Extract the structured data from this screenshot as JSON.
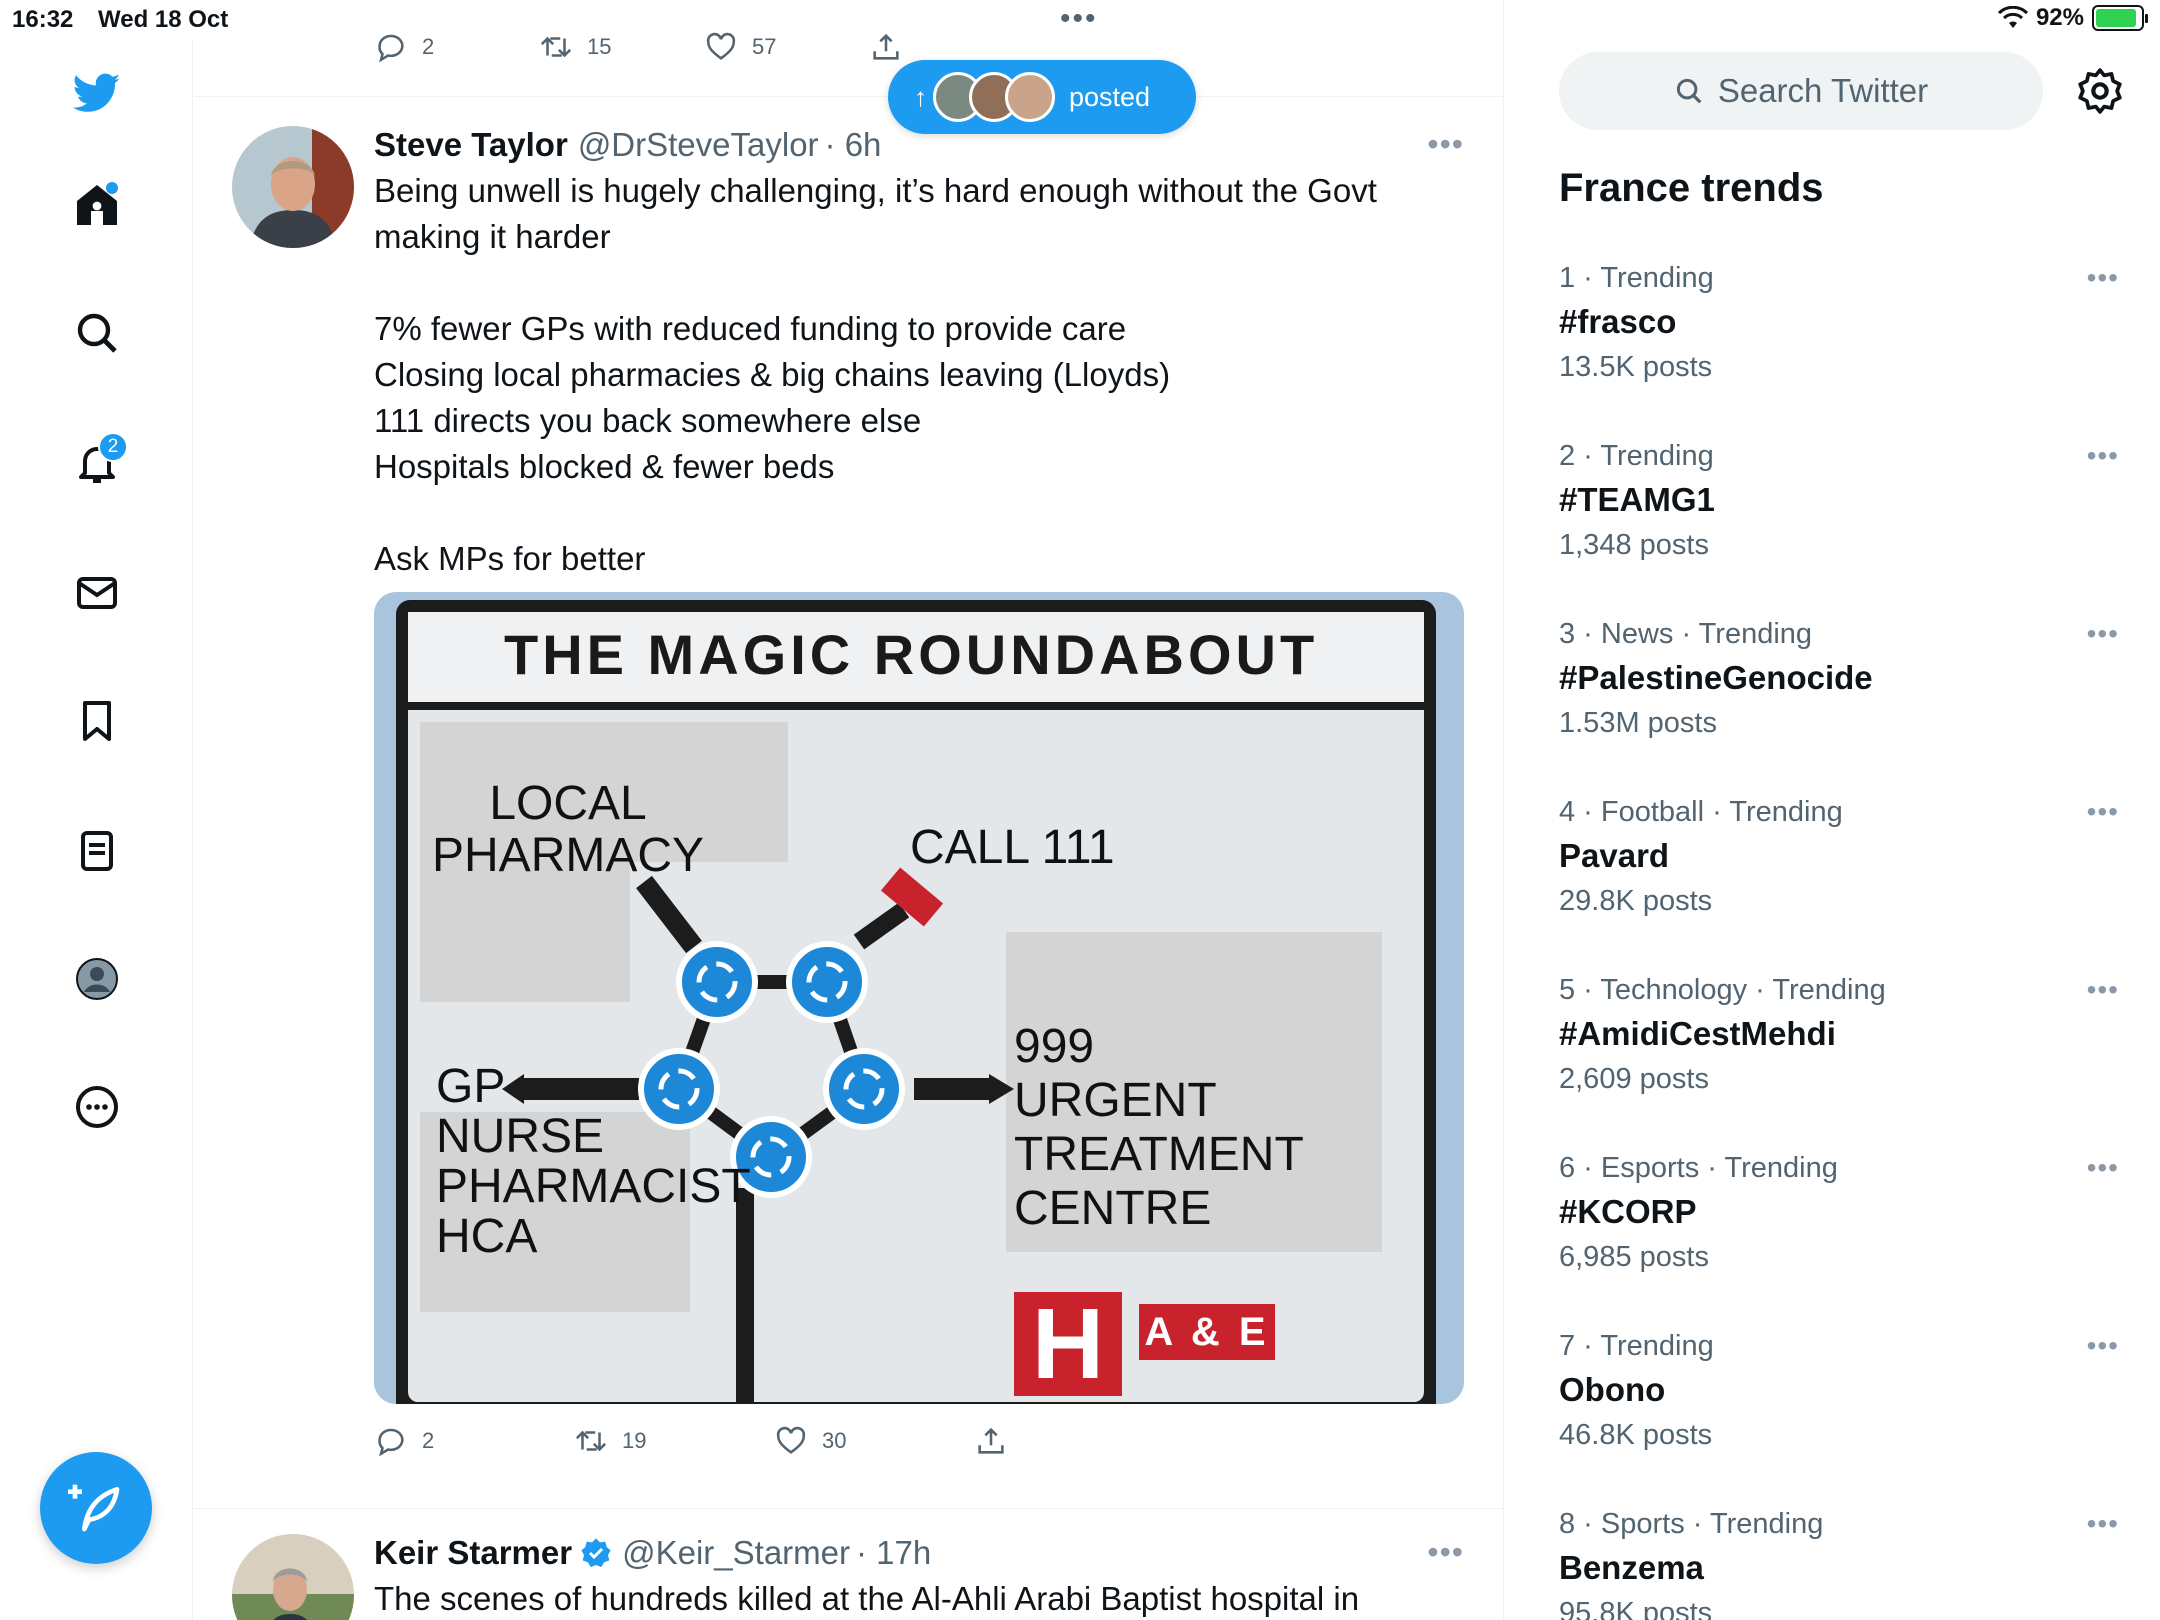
{
  "status_bar": {
    "time": "16:32",
    "date": "Wed 18 Oct",
    "battery": "92%",
    "battery_level": 0.92
  },
  "nav": {
    "notifications_badge": "2"
  },
  "colors": {
    "accent": "#1d9bf0",
    "text": "#0f1419",
    "muted": "#536471",
    "sign_red": "#c8232c"
  },
  "prev_tweet": {
    "replies": "2",
    "retweets": "15",
    "likes": "57"
  },
  "posted_pill": {
    "label": "posted"
  },
  "tweets": [
    {
      "name": "Steve Taylor",
      "handle": "@DrSteveTaylor",
      "time": "· 6h",
      "text": "Being unwell is hugely challenging, it’s hard enough without the Govt making it harder\n\n7% fewer GPs with reduced funding to provide care\nClosing local pharmacies & big chains leaving (Lloyds)\n111 directs you back somewhere else\nHospitals blocked & fewer beds\n\nAsk MPs for better",
      "media": {
        "title": "THE MAGIC ROUNDABOUT",
        "labels": {
          "pharmacy": "LOCAL\nPHARMACY",
          "call": "CALL 111",
          "gp": "GP\nNURSE\nPHARMACIST\nHCA",
          "urgent": "999\nURGENT\nTREATMENT\nCENTRE",
          "hospital": "H",
          "ae": "A & E"
        }
      },
      "replies": "2",
      "retweets": "19",
      "likes": "30"
    },
    {
      "name": "Keir Starmer",
      "handle": "@Keir_Starmer",
      "time": "· 17h",
      "text": "The scenes of hundreds killed at the Al-Ahli Arabi Baptist hospital in"
    }
  ],
  "sidebar": {
    "search_placeholder": "Search Twitter",
    "trends_title": "France trends",
    "trends": [
      {
        "meta": "1 · Trending",
        "name": "#frasco",
        "posts": "13.5K posts"
      },
      {
        "meta": "2 · Trending",
        "name": "#TEAMG1",
        "posts": "1,348 posts"
      },
      {
        "meta": "3 · News · Trending",
        "name": "#PalestineGenocide",
        "posts": "1.53M posts"
      },
      {
        "meta": "4 · Football · Trending",
        "name": "Pavard",
        "posts": "29.8K posts"
      },
      {
        "meta": "5 · Technology · Trending",
        "name": "#AmidiCestMehdi",
        "posts": "2,609 posts"
      },
      {
        "meta": "6 · Esports · Trending",
        "name": "#KCORP",
        "posts": "6,985 posts"
      },
      {
        "meta": "7 · Trending",
        "name": "Obono",
        "posts": "46.8K posts"
      },
      {
        "meta": "8 · Sports · Trending",
        "name": "Benzema",
        "posts": "95.8K posts"
      }
    ]
  }
}
